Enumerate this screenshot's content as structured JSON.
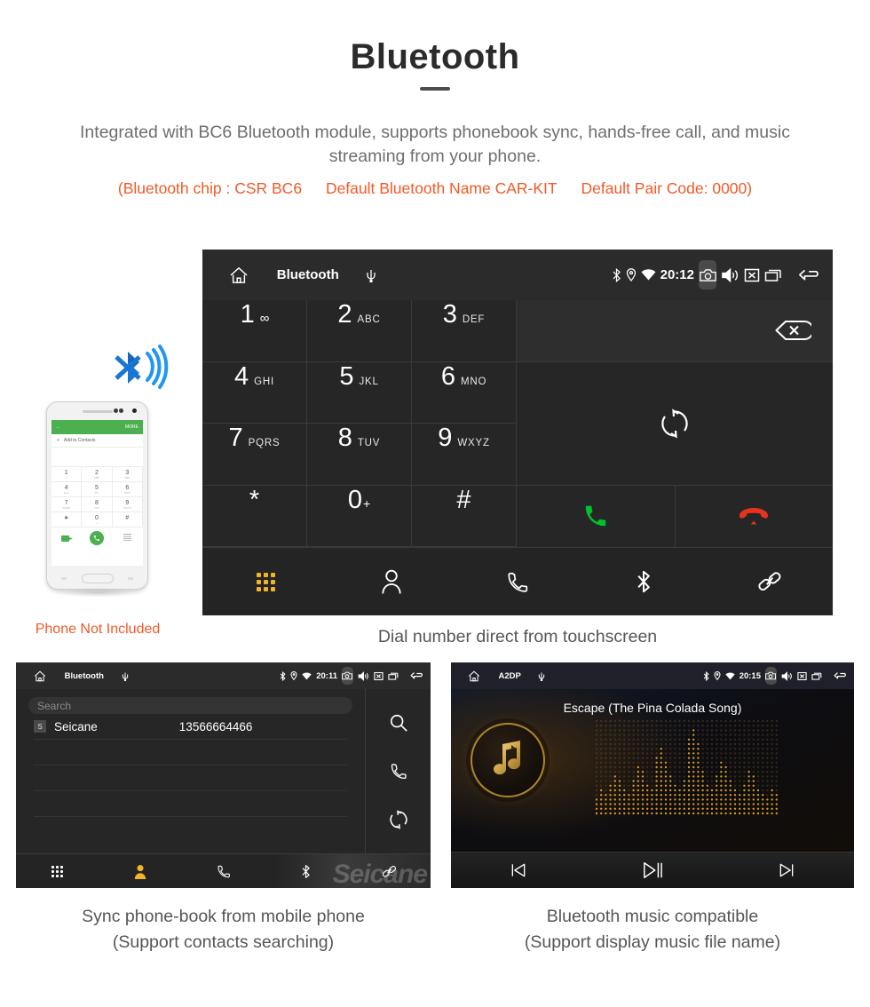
{
  "header": {
    "title": "Bluetooth",
    "subtitle": "Integrated with BC6 Bluetooth module, supports phonebook sync, hands-free call, and music streaming from your phone.",
    "specs": {
      "chip": "(Bluetooth chip : CSR BC6",
      "name": "Default Bluetooth Name CAR-KIT",
      "pair": "Default Pair Code: 0000)"
    }
  },
  "main_screen": {
    "statusbar": {
      "title": "Bluetooth",
      "clock": "20:12",
      "icons": [
        "home-icon",
        "usb-icon",
        "bluetooth-icon",
        "location-icon",
        "wifi-icon",
        "camera-icon",
        "volume-icon",
        "close-box-icon",
        "recents-icon",
        "back-icon"
      ]
    },
    "keypad": [
      {
        "num": "1",
        "letters": "",
        "voicemail": "oo"
      },
      {
        "num": "2",
        "letters": "ABC"
      },
      {
        "num": "3",
        "letters": "DEF"
      },
      {
        "num": "4",
        "letters": "GHI"
      },
      {
        "num": "5",
        "letters": "JKL"
      },
      {
        "num": "6",
        "letters": "MNO"
      },
      {
        "num": "7",
        "letters": "PQRS"
      },
      {
        "num": "8",
        "letters": "TUV"
      },
      {
        "num": "9",
        "letters": "WXYZ"
      },
      {
        "num": "*",
        "letters": ""
      },
      {
        "num": "0",
        "letters": "",
        "sup": "+"
      },
      {
        "num": "#",
        "letters": ""
      }
    ],
    "actions": {
      "backspace": "backspace-icon",
      "sync": "sync-icon",
      "call": "call-icon",
      "hangup": "hangup-icon"
    },
    "tabs": [
      {
        "name": "keypad",
        "icon": "keypad-grid-icon",
        "active": true
      },
      {
        "name": "contacts",
        "icon": "person-icon",
        "active": false
      },
      {
        "name": "call-log",
        "icon": "phone-icon",
        "active": false
      },
      {
        "name": "bluetooth",
        "icon": "bluetooth-icon",
        "active": false
      },
      {
        "name": "link",
        "icon": "link-icon",
        "active": false
      }
    ],
    "caption": "Dial number direct from touchscreen"
  },
  "phone_mock": {
    "screen_header_back": "←",
    "screen_header_more": "MORE",
    "add_to_contacts": "Add to Contacts",
    "keys": [
      {
        "num": "1",
        "sub": "∞"
      },
      {
        "num": "2",
        "sub": "ABC"
      },
      {
        "num": "3",
        "sub": "DEF"
      },
      {
        "num": "4",
        "sub": "GHI"
      },
      {
        "num": "5",
        "sub": "JKL"
      },
      {
        "num": "6",
        "sub": "MNO"
      },
      {
        "num": "7",
        "sub": "PQRS"
      },
      {
        "num": "8",
        "sub": "TUV"
      },
      {
        "num": "9",
        "sub": "WXYZ"
      },
      {
        "num": "∗",
        "sub": ""
      },
      {
        "num": "0",
        "sub": "+"
      },
      {
        "num": "#",
        "sub": ""
      }
    ],
    "not_included_label": "Phone Not Included"
  },
  "phonebook_screen": {
    "statusbar": {
      "title": "Bluetooth",
      "clock": "20:11"
    },
    "search_placeholder": "Search",
    "contacts": [
      {
        "initial": "S",
        "name": "Seicane",
        "number": "13566664466"
      }
    ],
    "side_actions": [
      "search-icon",
      "phone-icon",
      "sync-icon"
    ],
    "tabs": [
      {
        "name": "keypad",
        "icon": "keypad-grid-icon",
        "active": false
      },
      {
        "name": "contacts",
        "icon": "person-icon",
        "active": true
      },
      {
        "name": "call-log",
        "icon": "phone-icon",
        "active": false
      },
      {
        "name": "bluetooth",
        "icon": "bluetooth-icon",
        "active": false
      },
      {
        "name": "link",
        "icon": "link-icon",
        "active": false
      }
    ],
    "watermark": "Seicane",
    "caption_line1": "Sync phone-book from mobile phone",
    "caption_line2": "(Support contacts searching)"
  },
  "music_screen": {
    "statusbar": {
      "title": "A2DP",
      "clock": "20:15"
    },
    "track_title": "Escape (The Pina Colada Song)",
    "controls": [
      "previous-icon",
      "play-pause-icon",
      "next-icon"
    ],
    "caption_line1": "Bluetooth music compatible",
    "caption_line2": "(Support display music file name)"
  },
  "colors": {
    "accent_orange": "#f05a28",
    "tab_active": "#f0b429",
    "call_green": "#00c12b",
    "hangup_red": "#e8331c",
    "screen_bg": "#262626"
  }
}
